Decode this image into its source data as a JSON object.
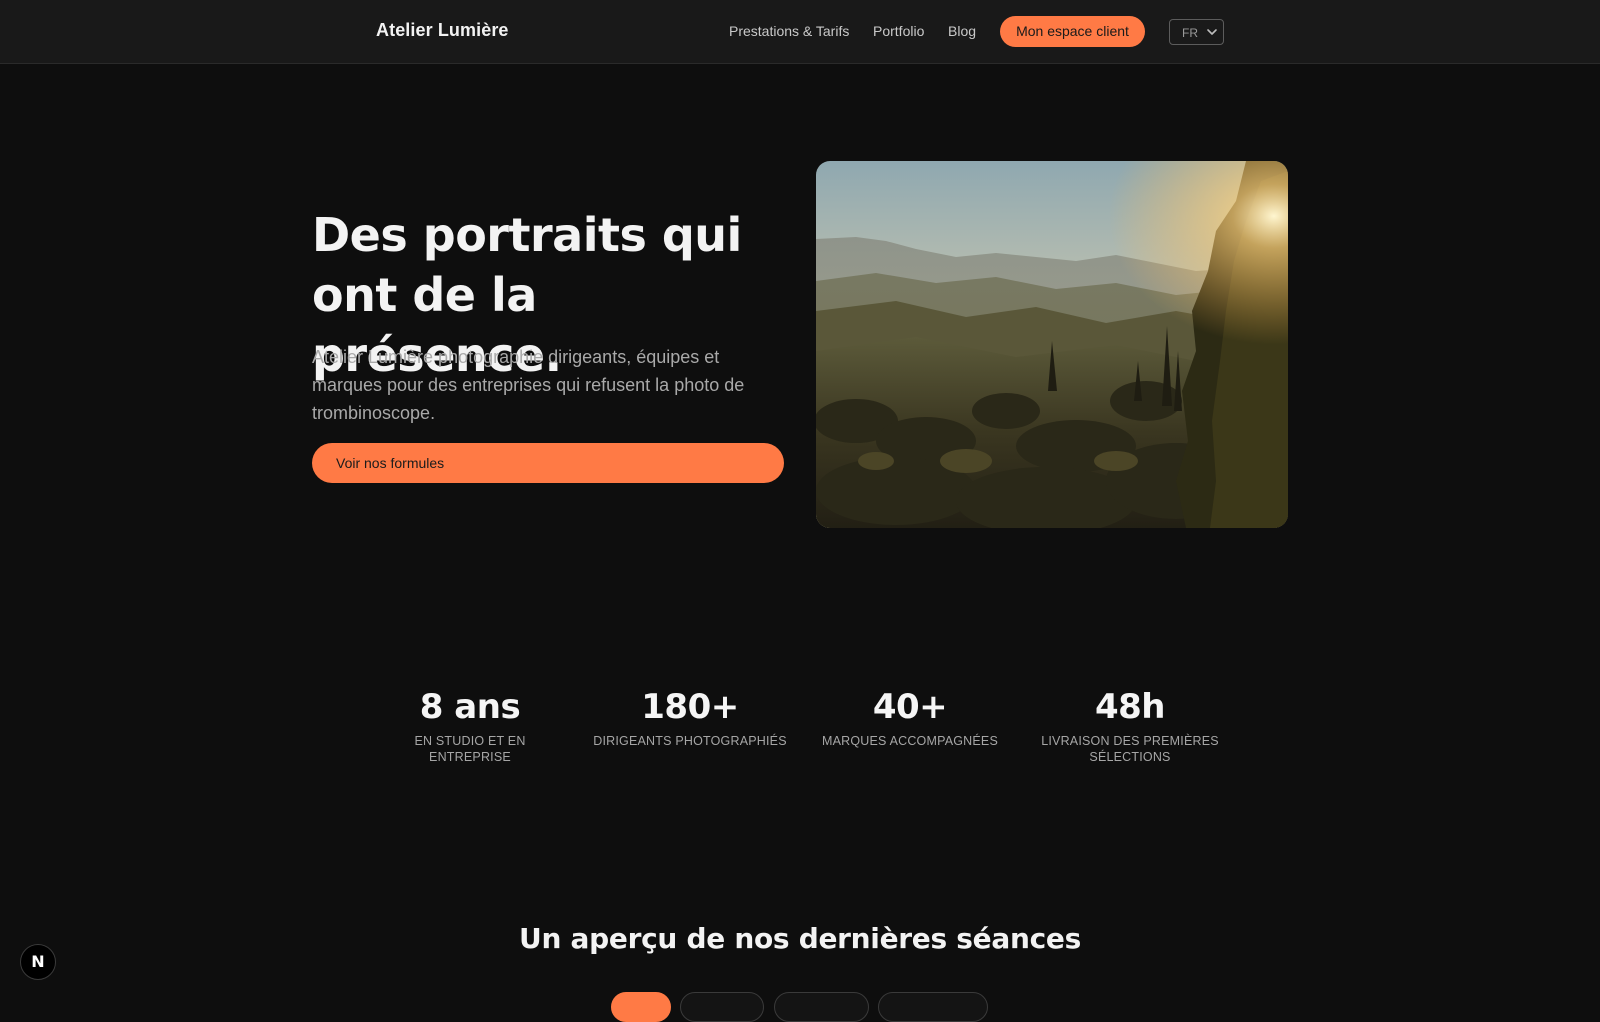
{
  "header": {
    "brand": "Atelier Lumière",
    "nav": [
      {
        "label": "Prestations & Tarifs"
      },
      {
        "label": "Portfolio"
      },
      {
        "label": "Blog"
      }
    ],
    "client_button": "Mon espace client",
    "language": "FR"
  },
  "hero": {
    "title": "Des portraits qui ont de la présence.",
    "subtitle": "Atelier Lumière photographie dirigeants, équipes et marques pour des entreprises qui refusent la photo de trombinoscope.",
    "cta": "Voir nos formules"
  },
  "stats": [
    {
      "value": "8 ans",
      "label": "En studio et en entreprise"
    },
    {
      "value": "180+",
      "label": "Dirigeants photographiés"
    },
    {
      "value": "40+",
      "label": "Marques accompagnées"
    },
    {
      "value": "48h",
      "label": "Livraison des premières sélections"
    }
  ],
  "gallery": {
    "title": "Un aperçu de nos dernières séances"
  },
  "colors": {
    "accent": "#ff7a45",
    "background": "#0e0e0e",
    "header_bg": "#191919"
  },
  "dev_badge": "N"
}
